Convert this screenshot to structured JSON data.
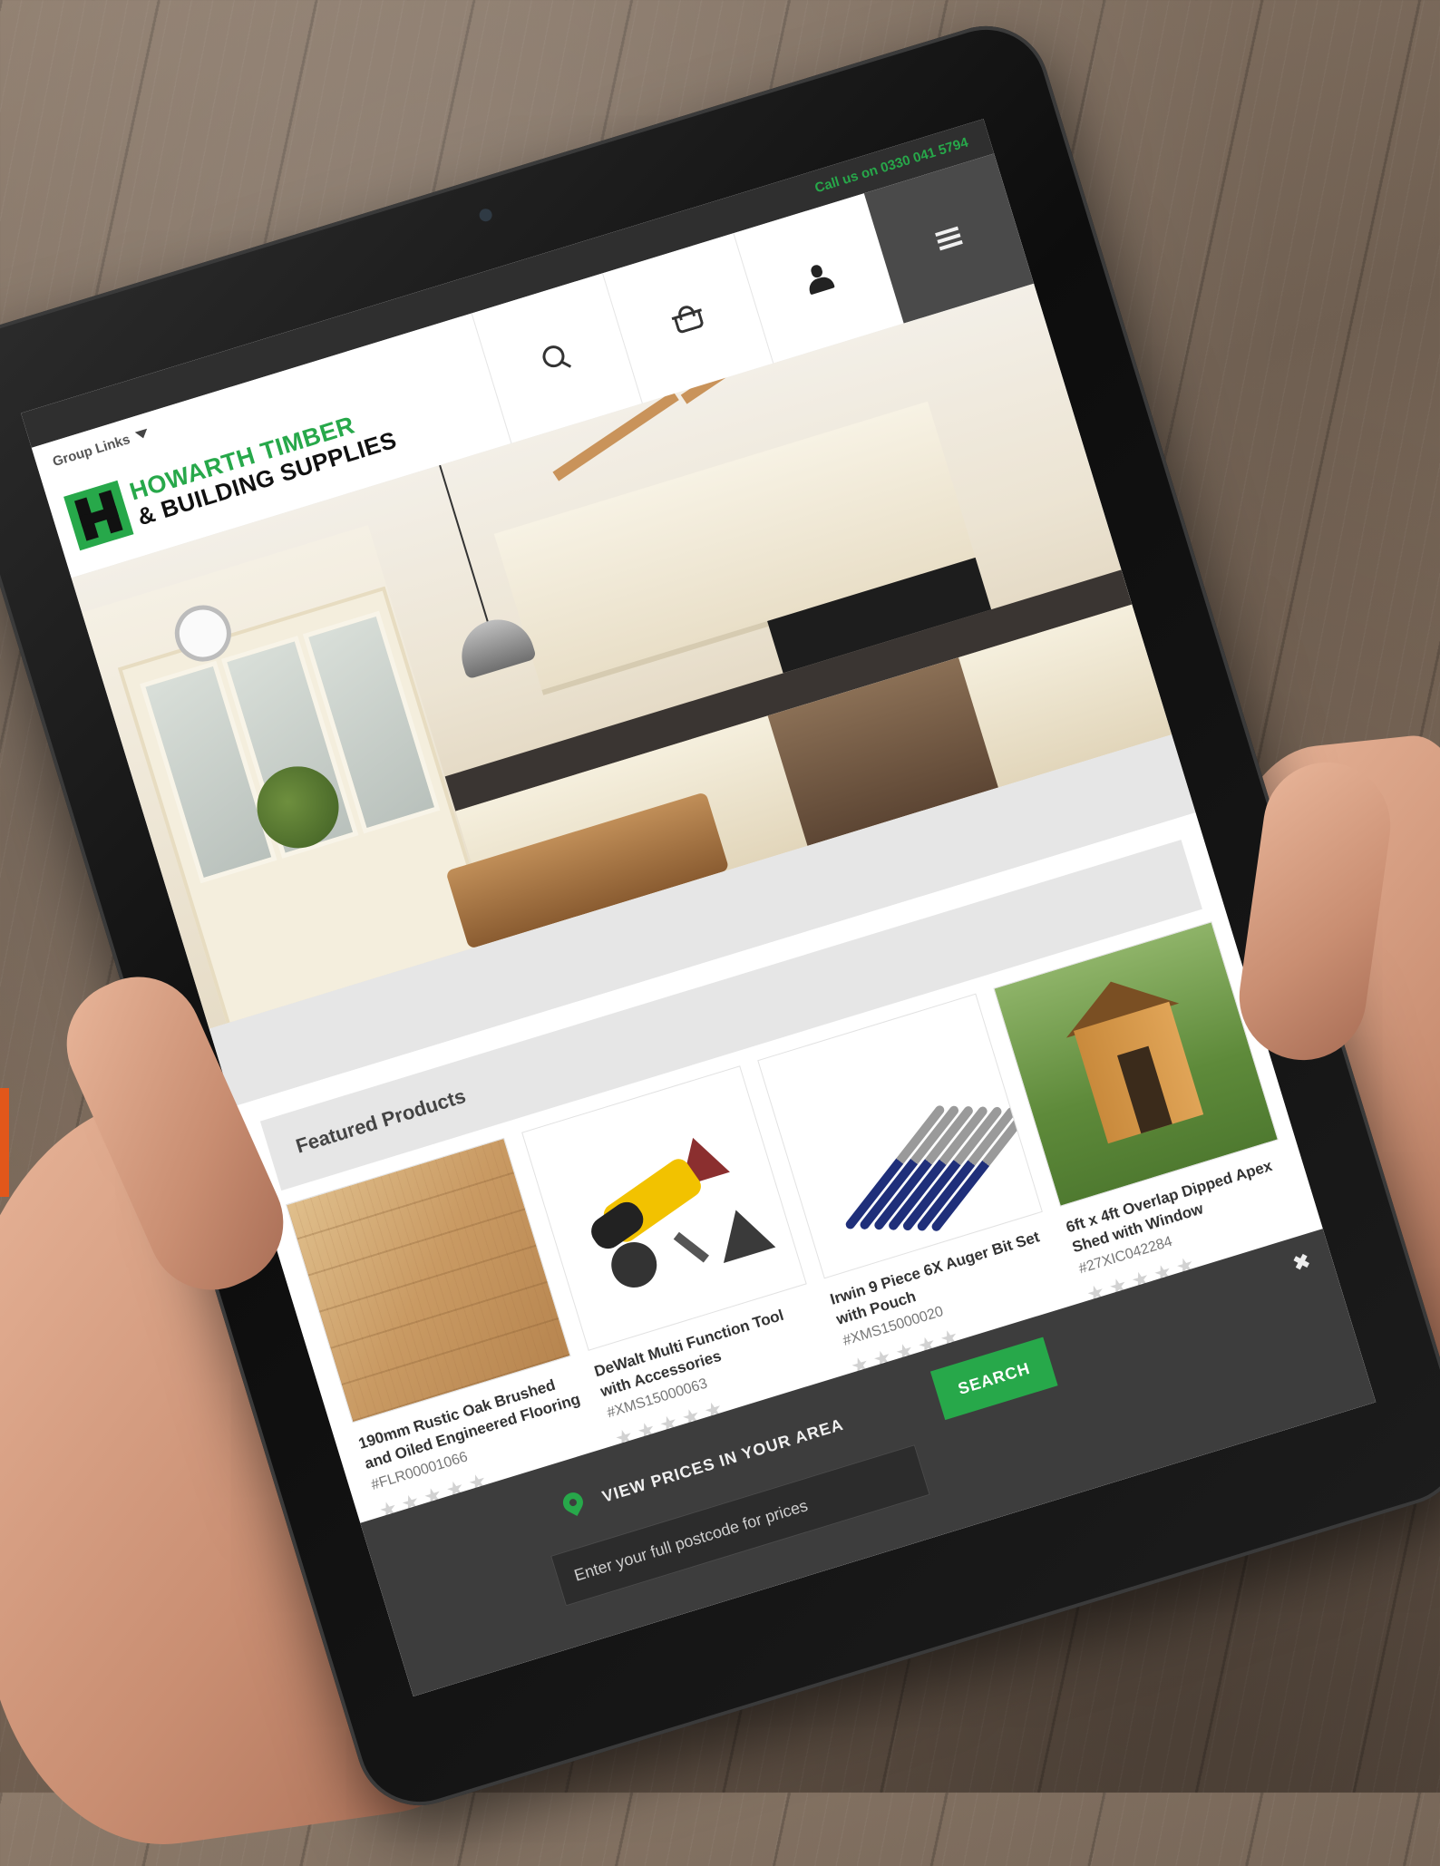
{
  "header": {
    "call_us": "Call us on 0330 041 5794",
    "group_links": "Group Links",
    "logo_line1": "HOWARTH TIMBER",
    "logo_line2": "& BUILDING SUPPLIES"
  },
  "icons": {
    "search": "search-icon",
    "basket": "basket-icon",
    "account": "user-icon",
    "menu": "menu-icon",
    "location": "pin-icon",
    "close": "close-icon"
  },
  "featured": {
    "title": "Featured Products",
    "products": [
      {
        "name": "190mm Rustic Oak Brushed and Oiled Engineered Flooring",
        "sku": "#FLR00001066",
        "stars": "★★★★★"
      },
      {
        "name": "DeWalt Multi Function Tool with Accessories",
        "sku": "#XMS15000063",
        "stars": "★★★★★"
      },
      {
        "name": "Irwin 9 Piece 6X Auger Bit Set with Pouch",
        "sku": "#XMS15000020",
        "stars": "★★★★★"
      },
      {
        "name": "6ft x 4ft Overlap Dipped Apex Shed with Window",
        "sku": "#27XIC042284",
        "stars": "★★★★★"
      }
    ]
  },
  "postcode": {
    "label": "VIEW PRICES IN YOUR AREA",
    "placeholder": "Enter your full postcode for prices",
    "search_label": "SEARCH",
    "close_glyph": "✖"
  },
  "colors": {
    "brand_green": "#27a84a",
    "dark_bar": "#3d3d3d",
    "menu_bg": "#4a4a4a"
  }
}
